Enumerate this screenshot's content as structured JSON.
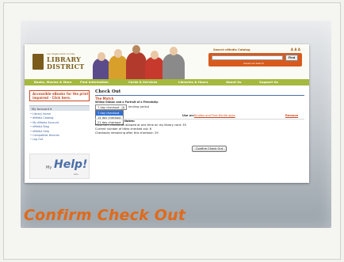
{
  "caption": "Confirm Check Out",
  "header": {
    "logo_subtitle": "Las Vegas-Clark County",
    "logo_line1": "LIBRARY",
    "logo_line2": "DISTRICT",
    "search_title": "Search eMedia Catalog",
    "font_tools": "A A A",
    "search_value": "",
    "find_label": "Find",
    "advanced_label": "Advanced Search"
  },
  "nav": {
    "items": [
      "Books, Movies & More",
      "Find Information",
      "Cards & Services",
      "Libraries & Hours",
      "About Us",
      "Support Us"
    ]
  },
  "sidebar": {
    "notice": "Accessible eBooks for the print impaired - Click here.",
    "account_label": "My Account ▾",
    "links": [
      "• Library Home",
      "• eMedia Catalog",
      "• My eMedia Account",
      "• eMedia Blog",
      "• eMedia Help",
      "• Compatible Devices",
      "• Log Out"
    ],
    "help_prefix": "My",
    "help_word": "Help!",
    "help_sub": "beta"
  },
  "main": {
    "heading": "Check Out",
    "title": "The Match",
    "subtitle": "Willow Gibson and a Portrait of a Friendship",
    "selected_period": "7 day checkout",
    "lending_text": "lending period",
    "options": [
      "7 day checkout",
      "14 day checkout",
      "21 day checkout"
    ],
    "selected_option_index": 0,
    "use_on": "Use on:",
    "use_on_link": "Kindles and Free Kindle apps",
    "remove_label": "Remove",
    "notes_heading": "Notes:",
    "note_lines": [
      "Maximum checkouts allowed at one time on my library card: 35",
      "Current number of titles checked out: 6",
      "Checkouts remaining after this checkout: 29"
    ],
    "confirm_label": "Confirm Check Out"
  },
  "colors": {
    "accent_orange": "#e06a1a",
    "nav_green": "#a4b93e",
    "link_red": "#c94a20",
    "select_blue": "#3070d6"
  }
}
